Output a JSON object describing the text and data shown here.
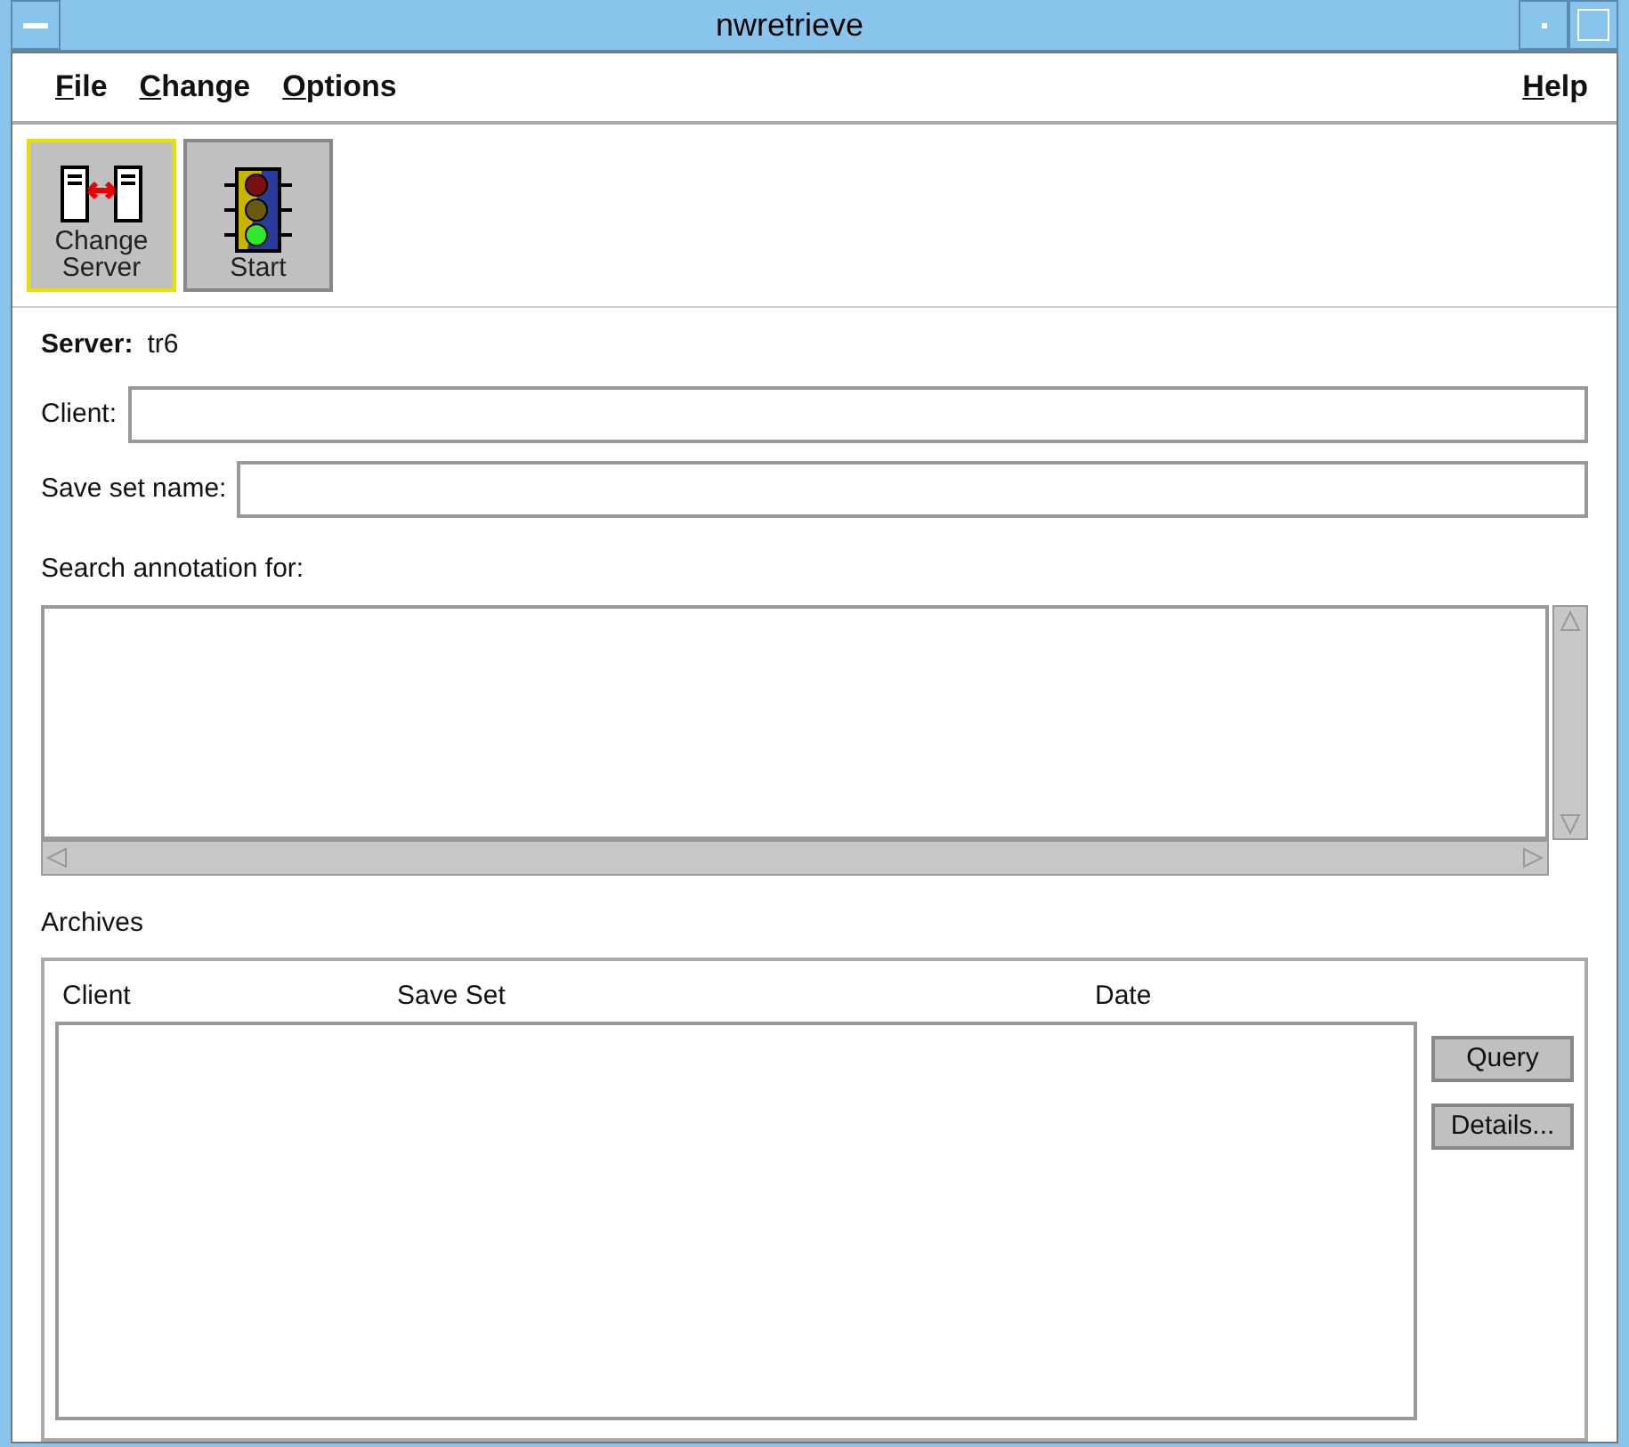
{
  "window": {
    "title": "nwretrieve"
  },
  "menu": {
    "left": [
      "File",
      "Change",
      "Options"
    ],
    "right": [
      "Help"
    ]
  },
  "toolbar": [
    {
      "label": "Change Server",
      "kind": "servers",
      "selected": true
    },
    {
      "label": "Start",
      "kind": "traffic",
      "selected": false
    }
  ],
  "server": {
    "label": "Server:",
    "value": "tr6"
  },
  "fields": [
    {
      "label": "Client:"
    },
    {
      "label": "Save set name:"
    }
  ],
  "annotation": {
    "label": "Search annotation for:"
  },
  "archives": {
    "label": "Archives",
    "columns": [
      "Client",
      "Save Set",
      "Date"
    ],
    "buttons": [
      "Query",
      "Details..."
    ]
  }
}
